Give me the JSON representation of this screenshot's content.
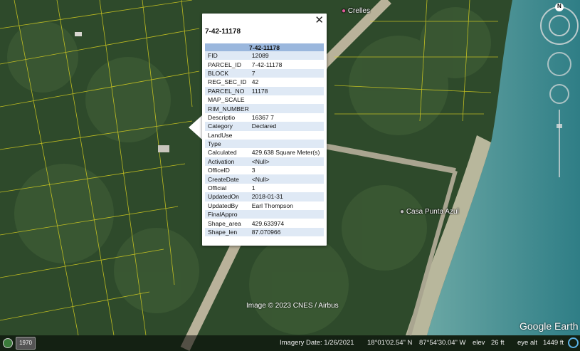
{
  "map": {
    "places": [
      {
        "name": "Crelles",
        "icon": "pink-pin-icon"
      },
      {
        "name": "Casa Punta Azul",
        "icon": "place-pin-icon"
      }
    ],
    "credit": "Image © 2023 CNES / Airbus",
    "logo": "Google Earth"
  },
  "popup": {
    "title": "7-42-11178",
    "table_header": "7-42-11178",
    "close_icon": "close-icon",
    "rows": [
      {
        "key": "FID",
        "value": "12089"
      },
      {
        "key": "PARCEL_ID",
        "value": "7-42-11178"
      },
      {
        "key": "BLOCK",
        "value": "7"
      },
      {
        "key": "REG_SEC_ID",
        "value": "42"
      },
      {
        "key": "PARCEL_NO",
        "value": "11178"
      },
      {
        "key": "MAP_SCALE",
        "value": ""
      },
      {
        "key": "RIM_NUMBER",
        "value": ""
      },
      {
        "key": "Descriptio",
        "value": "16367 7"
      },
      {
        "key": "Category",
        "value": "Declared"
      },
      {
        "key": "LandUse",
        "value": ""
      },
      {
        "key": "Type",
        "value": ""
      },
      {
        "key": "Calculated",
        "value": "429.638 Square Meter(s)"
      },
      {
        "key": "Activation",
        "value": "<Null>"
      },
      {
        "key": "OfficeID",
        "value": "3"
      },
      {
        "key": "CreateDate",
        "value": "<Null>"
      },
      {
        "key": "Official",
        "value": "1"
      },
      {
        "key": "UpdatedOn",
        "value": "2018-01-31"
      },
      {
        "key": "UpdatedBy",
        "value": "Earl Thompson"
      },
      {
        "key": "FinalAppro",
        "value": ""
      },
      {
        "key": "Shape_area",
        "value": "429.633974"
      },
      {
        "key": "Shape_len",
        "value": "87.070966"
      }
    ]
  },
  "status_bar": {
    "year": "1970",
    "imagery_date": "Imagery Date: 1/26/2021",
    "lat": "18°01'02.54\" N",
    "lon": "87°54'30.04\" W",
    "elev_label": "elev",
    "elev_value": "26 ft",
    "eye_alt_label": "eye alt",
    "eye_alt_value": "1449 ft"
  },
  "nav": {
    "north_label": "N"
  },
  "colors": {
    "parcel_lines": "#d8d020",
    "table_header": "#9ab7dd",
    "row_alt": "#dfe9f5"
  }
}
